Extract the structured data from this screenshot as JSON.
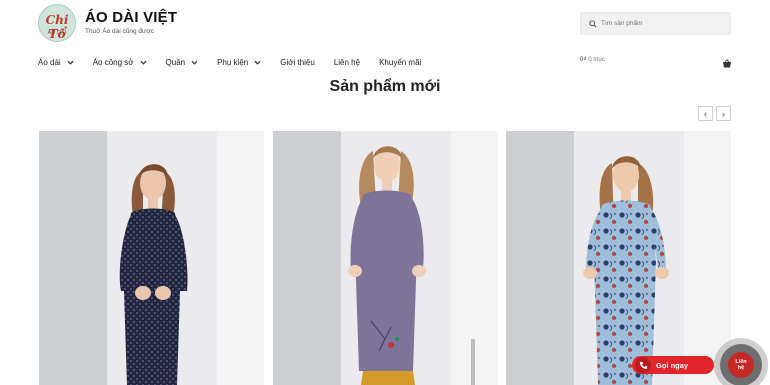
{
  "brand": {
    "logo_script": "Chi Tổ",
    "logo_sub": "ÁO DÀI",
    "name": "ÁO DÀI VIỆT",
    "tagline": "Thuở Áo dài cũng được"
  },
  "search": {
    "placeholder": "Tìm sản phẩm",
    "icon": "search-icon"
  },
  "nav": {
    "items": [
      {
        "label": "Áo dài",
        "has_dropdown": true
      },
      {
        "label": "Áo công sở",
        "has_dropdown": true
      },
      {
        "label": "Quần",
        "has_dropdown": true
      },
      {
        "label": "Phụ kiện",
        "has_dropdown": true
      },
      {
        "label": "Giới thiệu",
        "has_dropdown": false
      },
      {
        "label": "Liên hệ",
        "has_dropdown": false
      },
      {
        "label": "Khuyến mãi",
        "has_dropdown": false
      }
    ]
  },
  "cart": {
    "total": "0₫",
    "count": "0 mục",
    "icon": "basket-icon"
  },
  "section": {
    "title": "Sản phẩm mới",
    "prev_label": "‹",
    "next_label": "›"
  },
  "products": [
    {
      "dress_color": "#23263f",
      "pattern": "dots",
      "icon": "product-image"
    },
    {
      "dress_color": "#7e7499",
      "pattern": "plain",
      "icon": "product-image"
    },
    {
      "dress_color": "#9ec0dc",
      "pattern": "floral",
      "icon": "product-image"
    }
  ],
  "floating": {
    "call_label": "Gọi ngay",
    "contact_label_1": "Liên",
    "contact_label_2": "hệ"
  },
  "colors": {
    "accent_red": "#e0262b",
    "text_dark": "#222222"
  }
}
